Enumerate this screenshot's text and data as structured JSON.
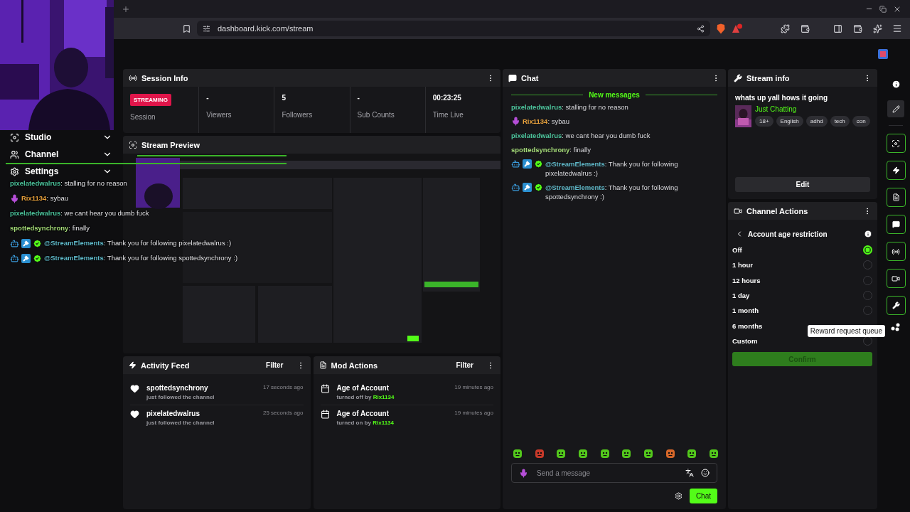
{
  "browser": {
    "url": "dashboard.kick.com/stream"
  },
  "sidebar": {
    "items": [
      {
        "label": "Studio",
        "kind": "studio"
      },
      {
        "label": "Channel",
        "kind": "channel"
      },
      {
        "label": "Settings",
        "kind": "settings"
      }
    ]
  },
  "session_info": {
    "title": "Session Info",
    "status_badge": "STREAMING",
    "status_label": "Session",
    "stats": [
      {
        "value": "-",
        "label": "Viewers"
      },
      {
        "value": "5",
        "label": "Followers"
      },
      {
        "value": "-",
        "label": "Sub Counts"
      },
      {
        "value": "00:23:25",
        "label": "Time Live"
      }
    ]
  },
  "stream_preview": {
    "title": "Stream Preview",
    "kind": "picture"
  },
  "stream_overlay_chat": {
    "messages": [
      {
        "user": "pixelatedwalrus",
        "color": "#4cc49c",
        "text": ": stalling for no reason"
      },
      {
        "user": "Rix1134",
        "color": "#e8a13c",
        "badges": [
          {
            "kind": "microphone"
          }
        ],
        "text": ": sybau"
      },
      {
        "user": "pixelatedwalrus",
        "color": "#4cc49c",
        "text": ": we cant hear you dumb fuck"
      },
      {
        "user": "spottedsynchrony",
        "color": "#a5dc78",
        "text": ": finally"
      },
      {
        "user": "@StreamElements",
        "color": "#5fb8c8",
        "badges": [
          {
            "kind": "bot"
          },
          {
            "kind": "moderator"
          },
          {
            "kind": "verified"
          }
        ],
        "text": ": Thank you for following pixelatedwalrus :)"
      },
      {
        "user": "@StreamElements",
        "color": "#5fb8c8",
        "badges": [
          {
            "kind": "bot"
          },
          {
            "kind": "moderator"
          },
          {
            "kind": "verified"
          }
        ],
        "text": ": Thank you for following spottedsynchrony :)"
      }
    ]
  },
  "activity_feed": {
    "title": "Activity Feed",
    "filter": "Filter",
    "items": [
      {
        "name": "spottedsynchrony",
        "detail": "just followed the channel",
        "time": "17 seconds ago"
      },
      {
        "name": "pixelatedwalrus",
        "detail": "just followed the channel",
        "time": "25 seconds ago"
      }
    ]
  },
  "mod_actions": {
    "title": "Mod Actions",
    "filter": "Filter",
    "items": [
      {
        "action": "Age of Account",
        "detail": "turned off by",
        "user": "Rix1134",
        "time": "19 minutes ago"
      },
      {
        "action": "Age of Account",
        "detail": "turned on by",
        "user": "Rix1134",
        "time": "19 minutes ago"
      }
    ]
  },
  "chat": {
    "title": "Chat",
    "divider": "New messages",
    "messages": [
      {
        "user": "pixelatedwalrus",
        "color": "#4cc49c",
        "text": ": stalling for no reason"
      },
      {
        "user": "Rix1134",
        "color": "#e8a13c",
        "badges": [
          {
            "kind": "microphone"
          }
        ],
        "text": ": sybau"
      },
      {
        "user": "pixelatedwalrus",
        "color": "#4cc49c",
        "text": ": we cant hear you dumb fuck"
      },
      {
        "user": "spottedsynchrony",
        "color": "#a5dc78",
        "text": ": finally"
      },
      {
        "user": "@StreamElements",
        "color": "#5fb8c8",
        "badges": [
          {
            "kind": "bot"
          },
          {
            "kind": "moderator"
          },
          {
            "kind": "verified"
          }
        ],
        "text": ": Thank you for following pixelatedwalrus :)"
      },
      {
        "user": "@StreamElements",
        "color": "#5fb8c8",
        "badges": [
          {
            "kind": "bot"
          },
          {
            "kind": "moderator"
          },
          {
            "kind": "verified"
          }
        ],
        "text": ": Thank you for following spottedsynchrony :)"
      }
    ],
    "input": {
      "placeholder": "Send a message"
    },
    "send_button": "Chat"
  },
  "stream_info": {
    "title": "Stream info",
    "stream_title": "whats up yall hows it going",
    "category": "Just Chatting",
    "tags": [
      "18+",
      "English",
      "adhd",
      "tech",
      "con"
    ],
    "edit_button": "Edit"
  },
  "channel_actions": {
    "title": "Channel Actions",
    "setting": "Account age restriction",
    "options": [
      {
        "label": "Off",
        "selected": true
      },
      {
        "label": "1 hour",
        "selected": false
      },
      {
        "label": "12 hours",
        "selected": false
      },
      {
        "label": "1 day",
        "selected": false
      },
      {
        "label": "1 month",
        "selected": false
      },
      {
        "label": "6 months"
      },
      {
        "label": "Custom",
        "selected": false
      }
    ],
    "confirm_button": "Confirm"
  },
  "tooltip": "Reward request queue"
}
